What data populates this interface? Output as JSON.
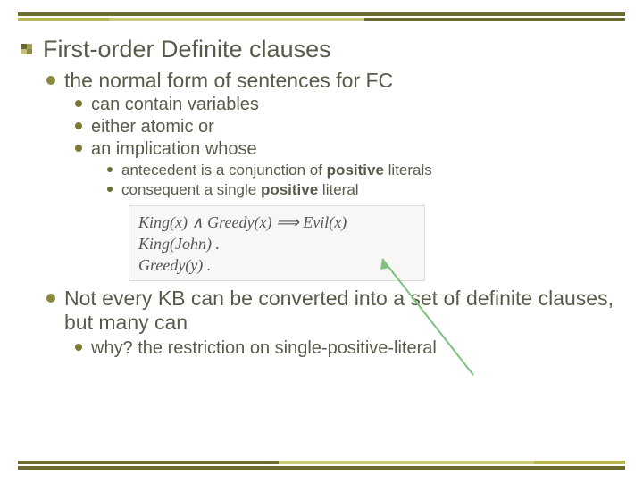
{
  "title": "First-order Definite clauses",
  "lvl1_a": "the normal form of sentences for FC",
  "lvl2": {
    "a": "can contain variables",
    "b": "either atomic or",
    "c": "an implication whose"
  },
  "lvl3": {
    "a_pre": "antecedent is a conjunction of ",
    "a_bold": "positive",
    "a_post": " literals",
    "b_pre": "consequent a single ",
    "b_bold": "positive",
    "b_post": " literal"
  },
  "formula": {
    "l1": "King(x) ∧ Greedy(x) ⟹ Evil(x)",
    "l2": "King(John) .",
    "l3": "Greedy(y) ."
  },
  "lvl1_b": "Not every KB can be converted into a set of definite clauses, but many can",
  "lvl2_b": "why? the restriction on single-positive-literal"
}
